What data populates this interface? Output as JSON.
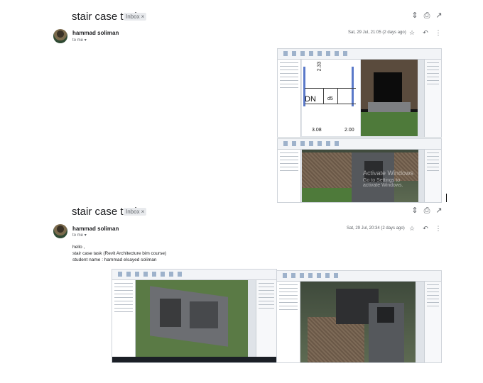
{
  "messages": [
    {
      "subject": "stair case task",
      "label": "Inbox",
      "sender": "hammad soliman",
      "recipient": "to me",
      "date": "Sat, 29 Jul, 21:05 (2 days ago)",
      "body": [],
      "attachments": [
        "revit-stair-plan-and-3d-view",
        "revit-3d-house-view"
      ]
    },
    {
      "subject": "stair case task",
      "label": "Inbox",
      "sender": "hammad soliman",
      "recipient": "to me",
      "date": "Sat, 29 Jul, 20:34 (2 days ago)",
      "body": [
        "hello ,",
        "stair case task (Revit Architecture bim course)",
        "student name : hammad elsayed soliman"
      ],
      "attachments": [
        "revit-3d-model-view",
        "revit-3d-roof-view"
      ]
    }
  ],
  "plan_labels": {
    "dn": "DN",
    "d5": "d5",
    "dim_left": "3.08",
    "dim_right": "2.00",
    "dim_vertical": "2.33"
  },
  "watermark": {
    "line1": "Activate Windows",
    "line2": "Go to Settings to activate Windows."
  },
  "icons": {
    "collapse": "unfold-less-icon",
    "print": "print-icon",
    "open": "open-in-new-icon",
    "star": "star-icon",
    "reply": "reply-icon",
    "more": "more-vert-icon"
  },
  "colors": {
    "chip_bg": "#e8eaed",
    "text": "#202124",
    "muted": "#5f6368"
  }
}
